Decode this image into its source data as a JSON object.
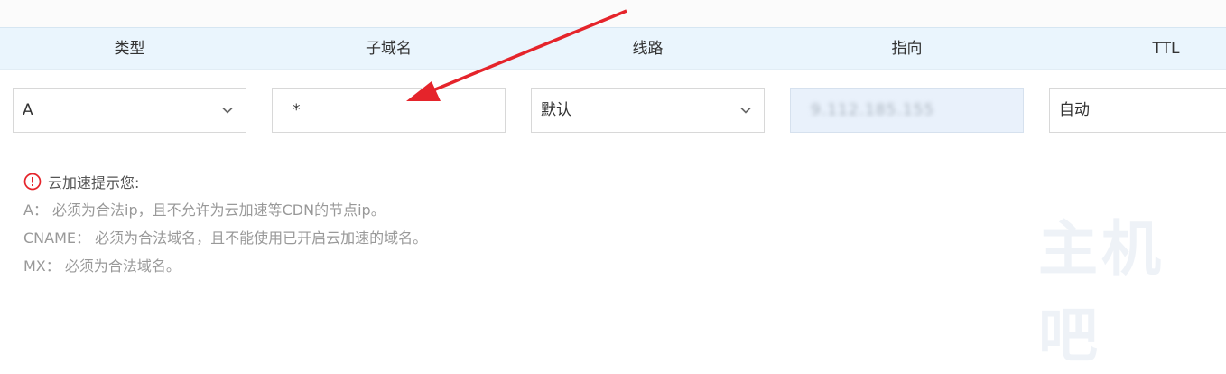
{
  "headers": {
    "type": "类型",
    "subdomain": "子域名",
    "line": "线路",
    "target": "指向",
    "ttl": "TTL"
  },
  "row": {
    "type": "A",
    "subdomain": "*",
    "line": "默认",
    "target": "9.112.185.155",
    "ttl": "自动"
  },
  "tips": {
    "title": "云加速提示您:",
    "lines": [
      "A：  必须为合法ip，且不允许为云加速等CDN的节点ip。",
      "CNAME：  必须为合法域名，且不能使用已开启云加速的域名。",
      "MX：  必须为合法域名。"
    ]
  },
  "watermark": "主机吧",
  "colors": {
    "header_bg": "#eaf5fd",
    "annotation_red": "#e5242b",
    "disabled_bg": "#e9f1fb"
  }
}
